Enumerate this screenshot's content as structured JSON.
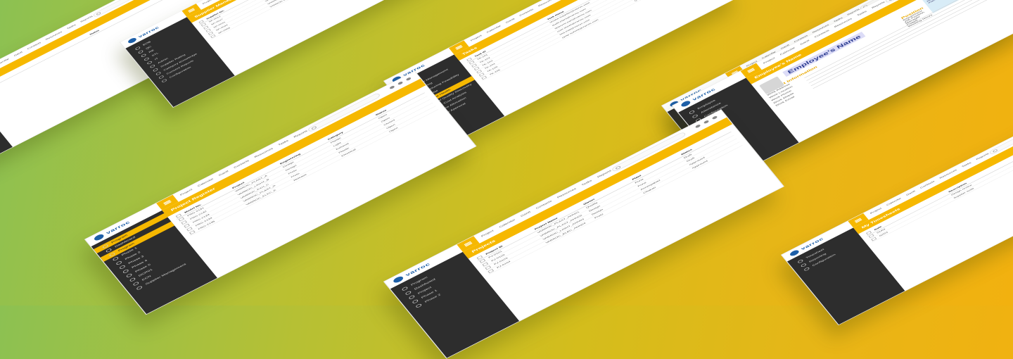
{
  "app": {
    "brand": "varroc",
    "brand_tagline": "Excellence Through Quality",
    "colors": {
      "accent": "#f6b800",
      "sidebar": "#2d2d2d",
      "brand": "#1d5fa8"
    }
  },
  "top_nav": [
    "Project",
    "Calendar",
    "Gantt",
    "Contacts",
    "Resources",
    "Tasks",
    "Reports"
  ],
  "screens": [
    {
      "name": "supplier-management",
      "title": "Supplier Management",
      "sidebar": [
        "EOB",
        "QC",
        "RE",
        "STL",
        "IT",
        "Admin",
        "Supplier Rating",
        "Category Knowledge",
        "Consent Reports",
        "Configuration"
      ],
      "columns": [
        "Supplier No.",
        "Supplier Name",
        "Category",
        "Status"
      ],
      "rows": [
        [
          "SP-0012",
          "VARROC POLYMERS",
          "Plastics",
          "Active"
        ],
        [
          "SP-0027",
          "VARROC ENGG",
          "Metals",
          "Active"
        ],
        [
          "SP-0031",
          "VARROC LIGHTING",
          "Electrical",
          "Pending"
        ],
        [
          "SP-0044",
          "VARROC EXHAUST",
          "Metals",
          "Active"
        ],
        [
          "SP-0058",
          "VARROC ELECTRICAL",
          "Electrical",
          "Active"
        ]
      ]
    },
    {
      "name": "employee-list",
      "title": "Employees",
      "sidebar": [
        "ESS",
        "Configuration"
      ],
      "columns": [
        "Name",
        "Email",
        "Department"
      ],
      "rows": [
        [
          "A. Sharma",
          "a.sharma@varroc.com",
          "QA"
        ],
        [
          "R. Patil",
          "r.patil@varroc.com",
          "IT"
        ],
        [
          "S. Kulkarni",
          "s.kulkarni@varroc.com",
          "HR"
        ]
      ]
    },
    {
      "name": "task-list",
      "title": "Tasks",
      "sidebar": [
        "ECN",
        "Supplier Management",
        "SE Tooling",
        "Manufacturing Feasibility",
        "TCM/TRM",
        "Financial Health",
        "Potential Quality Discovery",
        "Product Cost Analysis",
        "Resource Allocation",
        "Supplier Approval",
        "Profile",
        "Users"
      ],
      "active_sidebar": "Financial Health",
      "columns": [
        "Task ID",
        "Task Name",
        "Assigned To"
      ],
      "rows": [
        [
          "TK-101",
          "review.supplier@varroc.com",
          "Quality"
        ],
        [
          "TK-102",
          "audit.plant@varroc.com",
          "Audit"
        ],
        [
          "TK-103",
          "approve.part@varroc.com",
          "Purchase"
        ],
        [
          "TK-104",
          "cost.sheet@varroc.com",
          "Finance"
        ],
        [
          "TK-105",
          "tool.trial@varroc.com",
          "Tooling"
        ],
        [
          "TK-106",
          "ppap.submit@varroc.com",
          "Quality"
        ]
      ]
    },
    {
      "name": "employee-profile",
      "title": "Employee's Name",
      "sidebar": [
        "Employee",
        "Attendance",
        "Configuration"
      ],
      "sections": {
        "contact_title": "Contact Information",
        "contact_fields": [
          "Work Address",
          "Work Location",
          "Work Phone",
          "Work Mobile",
          "Work Email"
        ],
        "position_title": "Position",
        "position_fields": [
          "Department",
          "Job Position",
          "Manager",
          "Coach",
          "Working Hours"
        ],
        "note_title": "Organization Chart",
        "note_text": "No hierarchy position. This employee has no manager or subordinate."
      }
    },
    {
      "name": "project-register",
      "title": "Project Register",
      "sidebar": [
        "Program",
        "Dashboard",
        "Program",
        "Phase 1",
        "Phase 2",
        "Phase 3",
        "Phase 4",
        "Phase 5",
        "DCR01",
        "ECN",
        "Supplier Management"
      ],
      "active_sidebar": "Program",
      "columns": [
        "Model No.",
        "Project",
        "Engineering",
        "Category",
        "Status"
      ],
      "rows": [
        [
          "PRG-2131",
          "VARROC_PLAST_A",
          "Design",
          "Plastic",
          "Open"
        ],
        [
          "PRG-2132",
          "VARROC_LIGHT_B",
          "Design",
          "Light",
          "Open"
        ],
        [
          "PRG-2133",
          "VARROC_EXH_C",
          "Proto",
          "Exhaust",
          "Closed"
        ],
        [
          "PRG-2134",
          "VARROC_PLAST_D",
          "Proto",
          "Plastic",
          "Open"
        ],
        [
          "PRG-2135",
          "VARROC_ELEC_E",
          "Release",
          "Electrical",
          "Open"
        ]
      ]
    },
    {
      "name": "project-list",
      "title": "Projects",
      "sidebar": [
        "Program",
        "Dashboard",
        "Project",
        "Phase 1",
        "Phase 2"
      ],
      "columns": [
        "Project ID",
        "Project Name",
        "Owner",
        "Plant",
        "Status"
      ],
      "rows": [
        [
          "PJ-0101",
          "VARROC_PLAST_AHN01",
          "Quality",
          "Pune",
          "Draft"
        ],
        [
          "PJ-0102",
          "VARROC_PLAST_AHN02",
          "Design",
          "Pune",
          "Draft"
        ],
        [
          "PJ-0103",
          "VARROC_LIGHT_AHN03",
          "Design",
          "Aurangabad",
          "Approved"
        ],
        [
          "PJ-0104",
          "VARROC_ELEC_AHN04",
          "Proto",
          "Chakan",
          "Approved"
        ]
      ]
    },
    {
      "name": "my-timesheets",
      "title": "My Timesheets",
      "sidebar": [
        "Timesheet",
        "Reporting",
        "Configuration"
      ],
      "columns": [
        "Date",
        "Description",
        "Project"
      ],
      "rows": [
        [
          "01/03",
          "Design review",
          "VARROC_AHN"
        ],
        [
          "02/03",
          "Supplier audit",
          "VARROC_AHN"
        ]
      ]
    },
    {
      "name": "blank-list",
      "title": "List",
      "sidebar": [],
      "columns": [
        "Name",
        "Status"
      ],
      "rows": []
    }
  ]
}
